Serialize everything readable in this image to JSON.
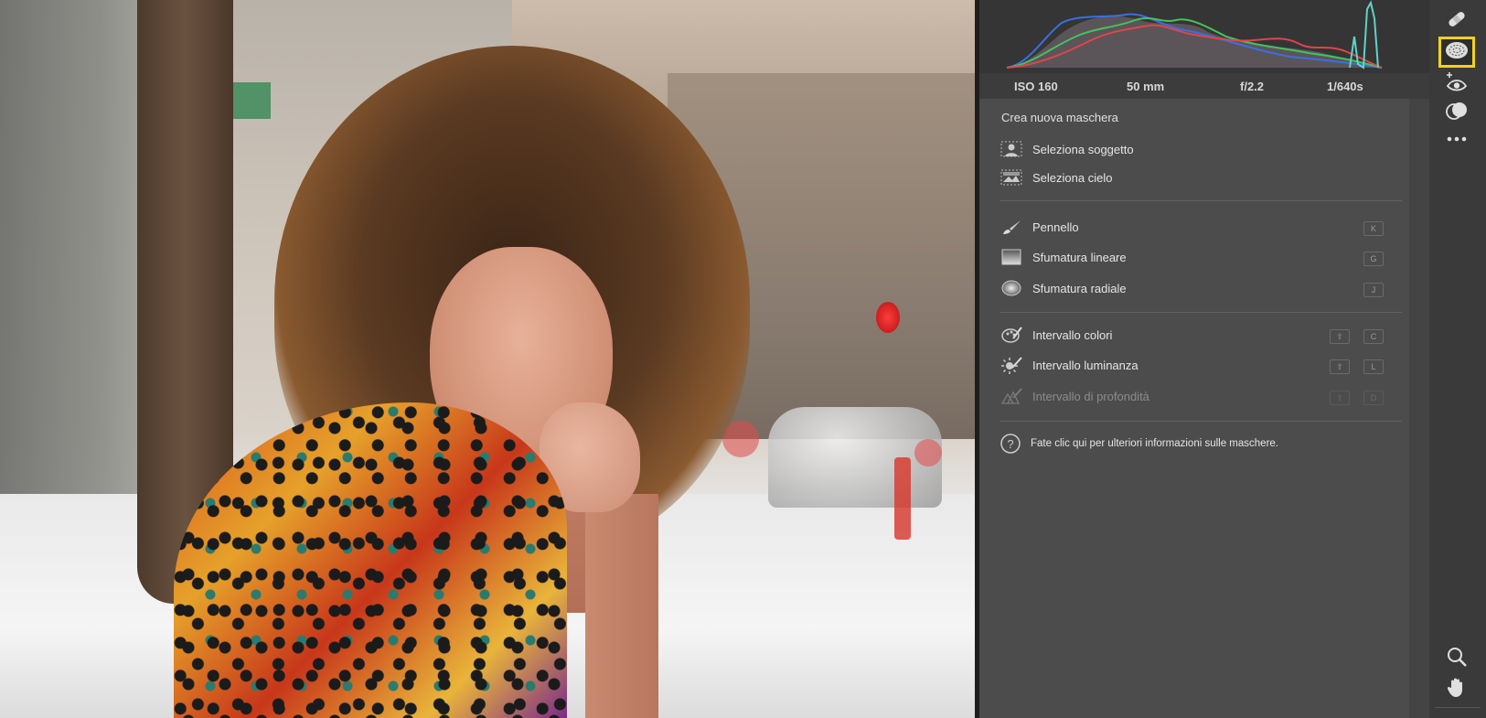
{
  "exif": {
    "iso": "ISO 160",
    "focal": "50 mm",
    "aperture": "f/2.2",
    "shutter": "1/640s"
  },
  "masks": {
    "title": "Crea nuova maschera",
    "ai_items": [
      {
        "label": "Seleziona soggetto",
        "icon": "select-subject-icon"
      },
      {
        "label": "Seleziona cielo",
        "icon": "select-sky-icon"
      }
    ],
    "brush_items": [
      {
        "label": "Pennello",
        "icon": "brush-icon",
        "key": "K"
      },
      {
        "label": "Sfumatura lineare",
        "icon": "linear-gradient-icon",
        "key": "G"
      },
      {
        "label": "Sfumatura radiale",
        "icon": "radial-gradient-icon",
        "key": "J"
      }
    ],
    "range_items": [
      {
        "label": "Intervallo colori",
        "icon": "color-range-icon",
        "modifier": "⇧",
        "key": "C"
      },
      {
        "label": "Intervallo luminanza",
        "icon": "luminance-range-icon",
        "modifier": "⇧",
        "key": "L"
      },
      {
        "label": "Intervallo di profondità",
        "icon": "depth-range-icon",
        "modifier": "⇧",
        "key": "D",
        "disabled": true
      }
    ],
    "help": "Fate clic qui per ulteriori informazioni sulle maschere."
  },
  "toolbar": {
    "tools": [
      "healing-icon",
      "masking-icon",
      "red-eye-icon",
      "presets-icon",
      "more-icon",
      "zoom-icon",
      "hand-icon"
    ],
    "active": "masking-icon",
    "accent": "#f2d21b"
  },
  "histogram_colors": {
    "red": "#e0454a",
    "green": "#46c15e",
    "blue": "#3a6fe0",
    "cyan": "#5fd3c8"
  }
}
